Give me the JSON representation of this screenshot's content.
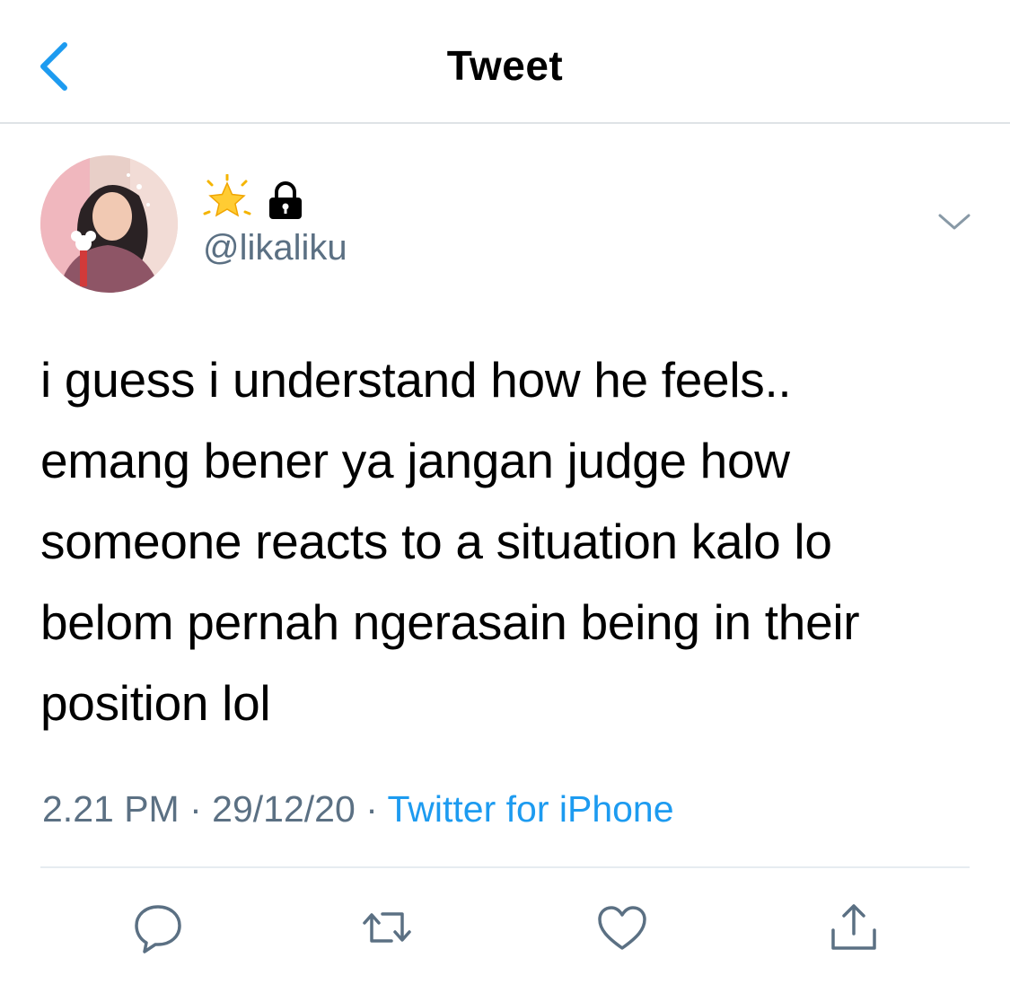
{
  "header": {
    "title": "Tweet"
  },
  "user": {
    "handle": "@likaliku"
  },
  "tweet": {
    "text": "i guess i understand how he feels..\nemang bener ya jangan judge how\nsomeone reacts to a situation kalo lo\nbelom pernah ngerasain being in their\nposition lol",
    "time": "2.21 PM",
    "date": "29/12/20",
    "separator": "·",
    "source": "Twitter for iPhone"
  },
  "colors": {
    "accent": "#1d9bf0",
    "secondary_text": "#5b7083",
    "divider": "#e6ecf0"
  },
  "icons": [
    "back-chevron-icon",
    "glowing-star-icon",
    "lock-icon",
    "chevron-down-icon",
    "reply-icon",
    "retweet-icon",
    "like-icon",
    "share-icon"
  ]
}
